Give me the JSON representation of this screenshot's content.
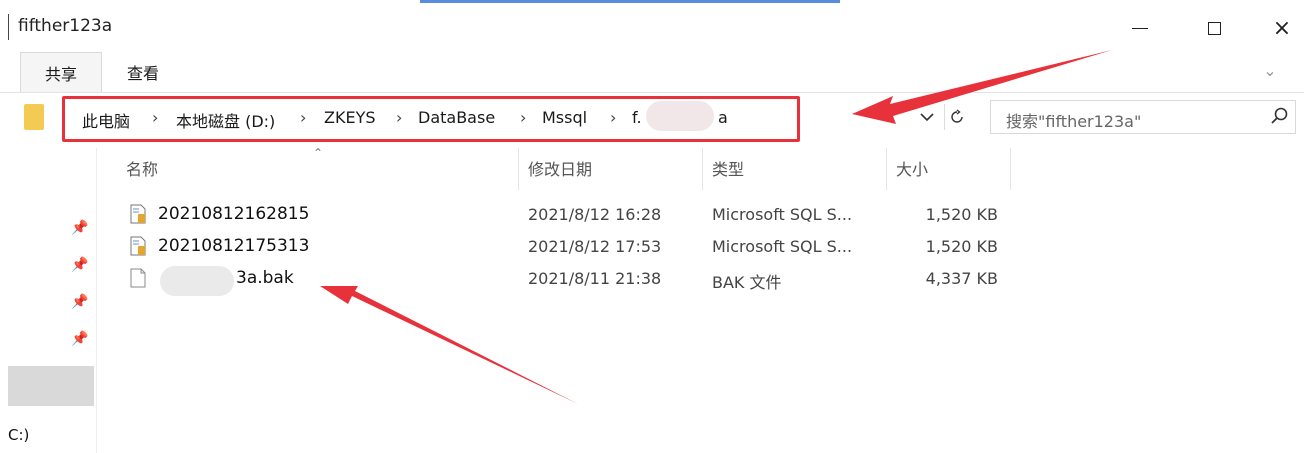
{
  "window": {
    "title": "fifther123a",
    "controls": {
      "minimize": "minimize",
      "maximize": "maximize",
      "close": "×"
    }
  },
  "ribbon": {
    "tabs": [
      {
        "label": "共享"
      },
      {
        "label": "查看"
      }
    ],
    "chevron": "⌄"
  },
  "address_bar": {
    "crumbs": [
      "此电脑",
      "本地磁盘 (D:)",
      "ZKEYS",
      "DataBase",
      "Mssql",
      "f.",
      "a"
    ],
    "separator": "›",
    "dropdown_icon": "chevron-down-icon",
    "refresh_icon": "refresh-icon",
    "annotation_color": "#e8323b"
  },
  "search": {
    "placeholder": "搜索\"fifther123a\""
  },
  "columns": [
    {
      "label": "名称"
    },
    {
      "label": "修改日期"
    },
    {
      "label": "类型"
    },
    {
      "label": "大小"
    }
  ],
  "files": [
    {
      "name": "20210812162815",
      "modified": "2021/8/12 16:28",
      "type": "Microsoft SQL S...",
      "size": "1,520 KB",
      "icon": "sql-file-icon"
    },
    {
      "name": "20210812175313",
      "modified": "2021/8/12 17:53",
      "type": "Microsoft SQL S...",
      "size": "1,520 KB",
      "icon": "sql-file-icon"
    },
    {
      "name": "3a.bak",
      "modified": "2021/8/11 21:38",
      "type": "BAK 文件",
      "size": "4,337 KB",
      "icon": "blank-file-icon"
    }
  ],
  "left_pane": {
    "pins": [
      "pin-icon",
      "pin-icon",
      "pin-icon",
      "pin-icon"
    ],
    "drive_label": "C:)"
  }
}
